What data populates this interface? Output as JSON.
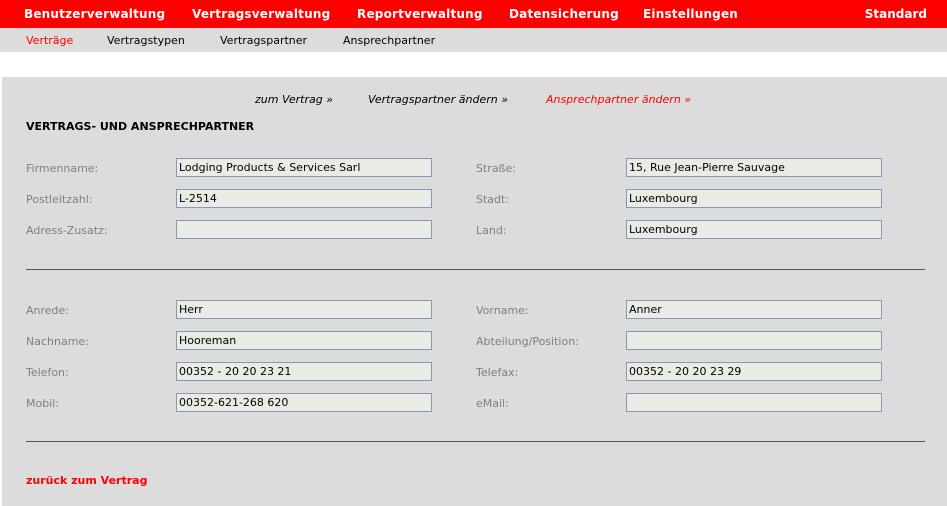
{
  "topnav": {
    "items": [
      "Benutzerverwaltung",
      "Vertragsverwaltung",
      "Reportverwaltung",
      "Datensicherung",
      "Einstellungen"
    ],
    "right": "Standard"
  },
  "subnav": {
    "items": [
      "Verträge",
      "Vertragstypen",
      "Vertragspartner",
      "Ansprechpartner"
    ]
  },
  "steps": [
    "zum Vertrag »",
    "Vertragspartner ändern »",
    "Ansprechpartner ändern »"
  ],
  "section_title": "VERTRAGS- UND ANSPRECHPARTNER",
  "partner": {
    "firmenname_label": "Firmenname:",
    "firmenname": "Lodging Products & Services Sarl",
    "strasse_label": "Straße:",
    "strasse": "15, Rue Jean-Pierre Sauvage",
    "plz_label": "Postleitzahl:",
    "plz": "L-2514",
    "stadt_label": "Stadt:",
    "stadt": "Luxembourg",
    "zusatz_label": "Adress-Zusatz:",
    "zusatz": "",
    "land_label": "Land:",
    "land": "Luxembourg"
  },
  "contact": {
    "anrede_label": "Anrede:",
    "anrede": "Herr",
    "vorname_label": "Vorname:",
    "vorname": "Anner",
    "nachname_label": "Nachname:",
    "nachname": "Hooreman",
    "abteilung_label": "Abteilung/Position:",
    "abteilung": "",
    "telefon_label": "Telefon:",
    "telefon": "00352 - 20 20 23 21",
    "telefax_label": "Telefax:",
    "telefax": "00352 - 20 20 23 29",
    "mobil_label": "Mobil:",
    "mobil": "00352-621-268 620",
    "email_label": "eMail:",
    "email": ""
  },
  "back_link": "zurück zum Vertrag",
  "colors": {
    "accent": "#ff0000",
    "panel": "#dcdcdc",
    "field": "#ebebe5",
    "field_border": "#7f9db9"
  }
}
